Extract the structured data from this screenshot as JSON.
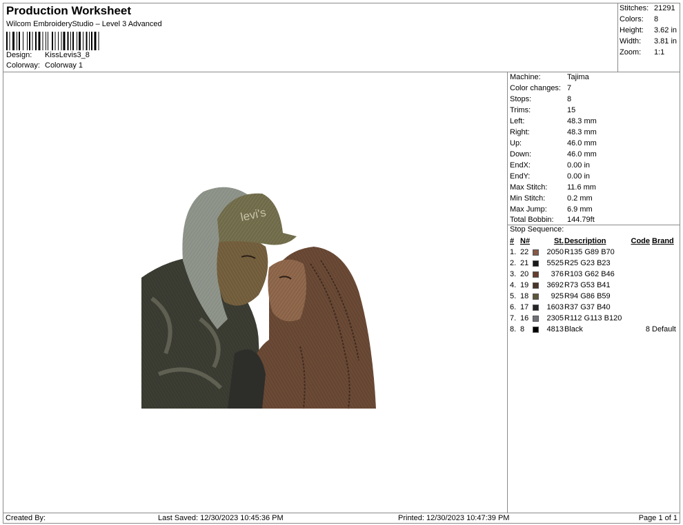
{
  "header": {
    "title": "Production Worksheet",
    "subtitle": "Wilcom EmbroideryStudio – Level 3 Advanced",
    "design_label": "Design:",
    "design_value": "KissLevis3_8",
    "colorway_label": "Colorway:",
    "colorway_value": "Colorway 1"
  },
  "stats": [
    {
      "label": "Stitches:",
      "value": "21291"
    },
    {
      "label": "Colors:",
      "value": "8"
    },
    {
      "label": "Height:",
      "value": "3.62 in"
    },
    {
      "label": "Width:",
      "value": "3.81 in"
    },
    {
      "label": "Zoom:",
      "value": "1:1"
    }
  ],
  "machine_info": [
    {
      "label": "Machine:",
      "value": "Tajima"
    },
    {
      "label": "Color changes:",
      "value": "7"
    },
    {
      "label": "Stops:",
      "value": "8"
    },
    {
      "label": "Trims:",
      "value": "15"
    },
    {
      "label": "Left:",
      "value": "48.3 mm"
    },
    {
      "label": "Right:",
      "value": "48.3 mm"
    },
    {
      "label": "Up:",
      "value": "46.0 mm"
    },
    {
      "label": "Down:",
      "value": "46.0 mm"
    },
    {
      "label": "EndX:",
      "value": "0.00 in"
    },
    {
      "label": "EndY:",
      "value": "0.00 in"
    },
    {
      "label": "Max Stitch:",
      "value": "11.6 mm"
    },
    {
      "label": "Min Stitch:",
      "value": "0.2 mm"
    },
    {
      "label": "Max Jump:",
      "value": "6.9 mm"
    },
    {
      "label": "Total Bobbin:",
      "value": "144.79ft"
    }
  ],
  "stop_sequence": {
    "title": "Stop Sequence:",
    "headers": {
      "num": "#",
      "n": "N#",
      "st": "St.",
      "desc": "Description",
      "code": "Code",
      "brand": "Brand"
    },
    "rows": [
      {
        "num": "1.",
        "n": "22",
        "color": "#875946",
        "st": "2050",
        "desc": "R135 G89 B70",
        "code": "",
        "brand": ""
      },
      {
        "num": "2.",
        "n": "21",
        "color": "#191717",
        "st": "5525",
        "desc": "R25 G23 B23",
        "code": "",
        "brand": ""
      },
      {
        "num": "3.",
        "n": "20",
        "color": "#673E2E",
        "st": "376",
        "desc": "R103 G62 B46",
        "code": "",
        "brand": ""
      },
      {
        "num": "4.",
        "n": "19",
        "color": "#493529",
        "st": "3692",
        "desc": "R73 G53 B41",
        "code": "",
        "brand": ""
      },
      {
        "num": "5.",
        "n": "18",
        "color": "#5E563B",
        "st": "925",
        "desc": "R94 G86 B59",
        "code": "",
        "brand": ""
      },
      {
        "num": "6.",
        "n": "17",
        "color": "#252528",
        "st": "1603",
        "desc": "R37 G37 B40",
        "code": "",
        "brand": ""
      },
      {
        "num": "7.",
        "n": "16",
        "color": "#707178",
        "st": "2305",
        "desc": "R112 G113 B120",
        "code": "",
        "brand": ""
      },
      {
        "num": "8.",
        "n": "8",
        "color": "#000000",
        "st": "4813",
        "desc": "Black",
        "code": "8",
        "brand": "Default"
      }
    ]
  },
  "footer": {
    "created_by": "Created By:",
    "last_saved": "Last Saved: 12/30/2023 10:45:36 PM",
    "printed": "Printed: 12/30/2023 10:47:39 PM",
    "page": "Page 1 of 1"
  },
  "artwork": {
    "cap_text": "levi's"
  }
}
